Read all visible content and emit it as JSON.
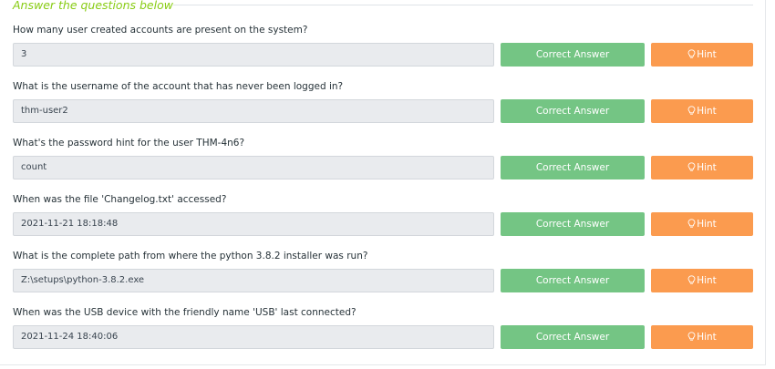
{
  "section": {
    "title": "Answer the questions below"
  },
  "buttons": {
    "correct_label": "Correct Answer",
    "hint_label": "Hint",
    "hint_icon": "lightbulb-icon",
    "correct_color": "#74c584",
    "hint_color": "#fb9b4f"
  },
  "accent_color": "#88cc14",
  "questions": [
    {
      "text": "How many user created accounts are present on the system?",
      "answer": "3"
    },
    {
      "text": "What is the username of the account that has never been logged in?",
      "answer": "thm-user2"
    },
    {
      "text": "What's the password hint for the user THM-4n6?",
      "answer": "count"
    },
    {
      "text": "When was the file 'Changelog.txt' accessed?",
      "answer": "2021-11-21 18:18:48"
    },
    {
      "text": "What is the complete path from where the python 3.8.2 installer was run?",
      "answer": "Z:\\setups\\python-3.8.2.exe"
    },
    {
      "text": "When was the USB device with the friendly name 'USB' last connected?",
      "answer": "2021-11-24 18:40:06"
    }
  ]
}
